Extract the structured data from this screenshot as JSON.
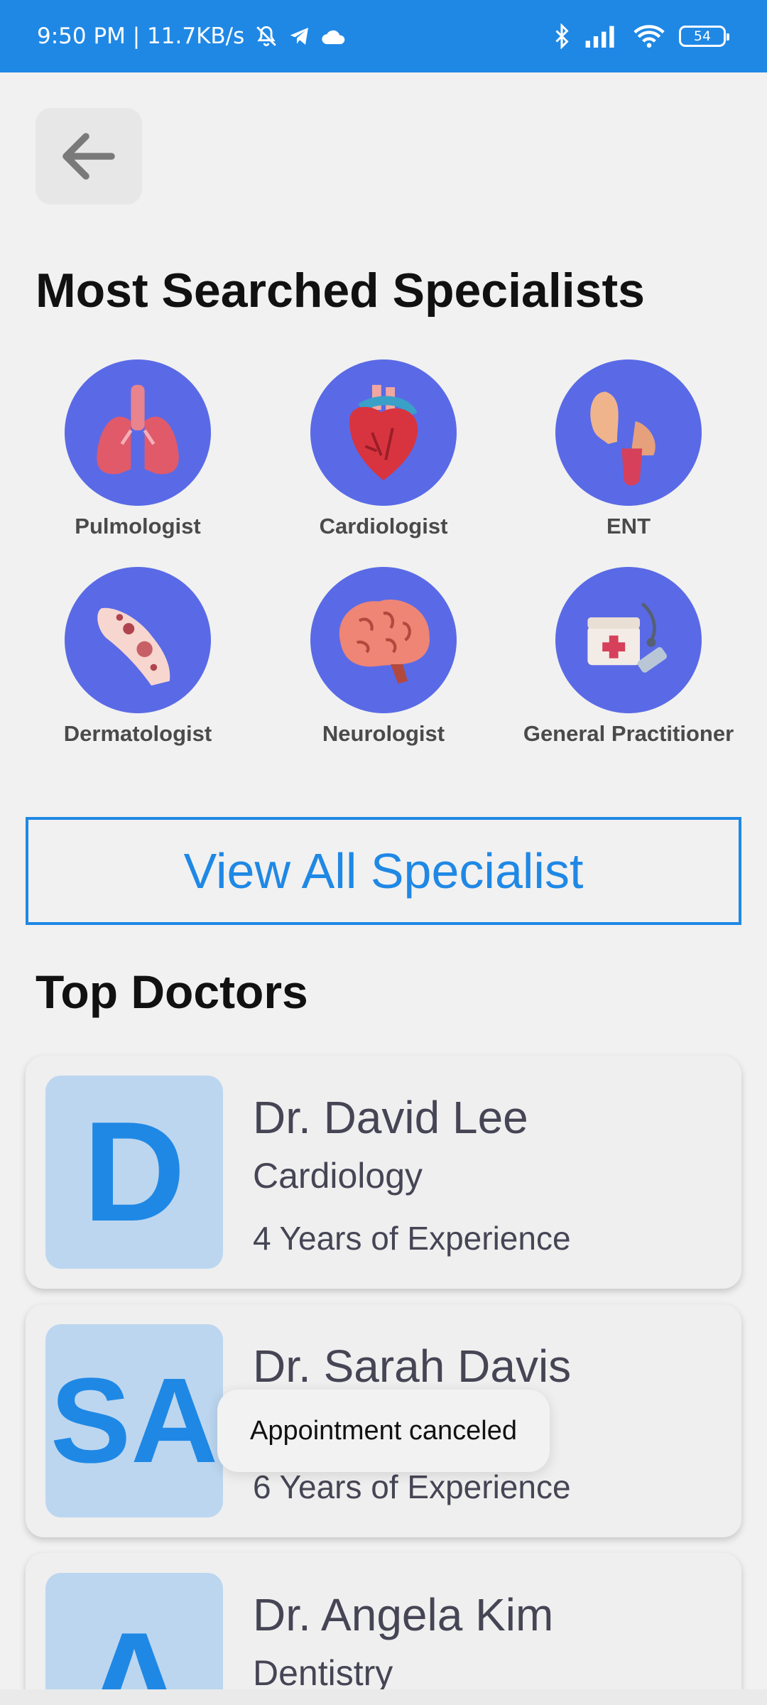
{
  "status_bar": {
    "time_speed": "9:50 PM | 11.7KB/s",
    "battery": "54",
    "icons": [
      "mute-icon",
      "telegram-icon",
      "cloud-icon",
      "bluetooth-icon",
      "signal-icon",
      "wifi-icon",
      "battery-icon"
    ]
  },
  "header": {
    "back_icon": "arrow-left-icon"
  },
  "specialists": {
    "title": "Most Searched Specialists",
    "items": [
      {
        "label": "Pulmologist",
        "icon": "lungs-icon"
      },
      {
        "label": "Cardiologist",
        "icon": "heart-icon"
      },
      {
        "label": "ENT",
        "icon": "ear-nose-throat-icon"
      },
      {
        "label": "Dermatologist",
        "icon": "skin-icon"
      },
      {
        "label": "Neurologist",
        "icon": "brain-icon"
      },
      {
        "label": "General Practitioner",
        "icon": "medical-kit-icon"
      }
    ],
    "view_all": "View All Specialist"
  },
  "top_doctors": {
    "title": "Top Doctors",
    "doctors": [
      {
        "initials": "D",
        "name": "Dr. David Lee",
        "specialty": "Cardiology",
        "experience": "4 Years of Experience"
      },
      {
        "initials": "SA",
        "name": "Dr. Sarah Davis",
        "specialty": "",
        "experience": "6 Years of Experience"
      },
      {
        "initials": "A",
        "name": "Dr. Angela Kim",
        "specialty": "Dentistry",
        "experience": ""
      }
    ]
  },
  "toast": {
    "message": "Appointment canceled"
  },
  "colors": {
    "primary": "#1f88e5",
    "specialist_bg": "#5a6ae6",
    "avatar_bg": "#bcd6f0"
  }
}
